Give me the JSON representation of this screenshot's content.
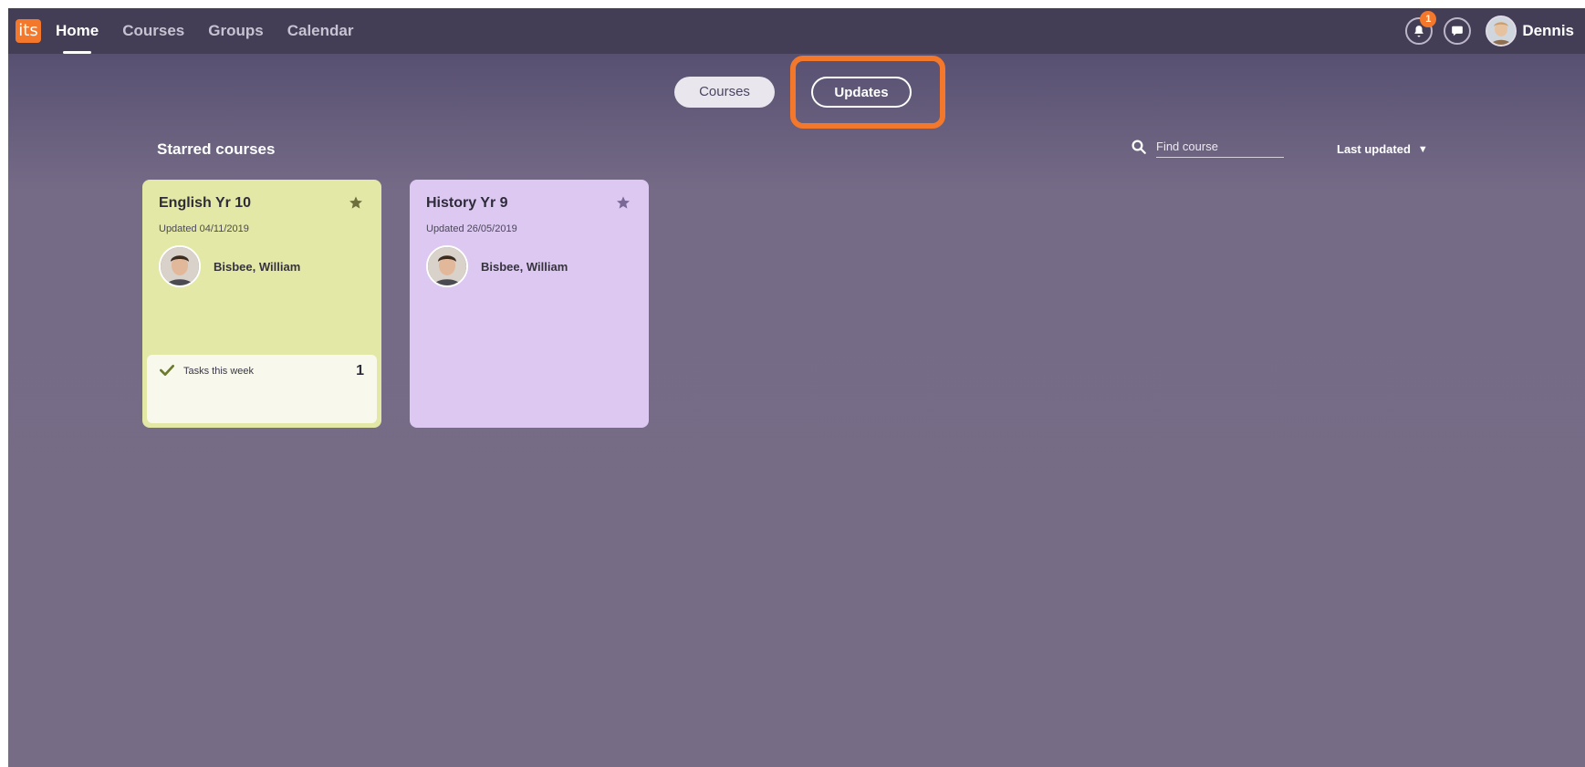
{
  "app": {
    "logo_text": "its"
  },
  "nav": {
    "items": [
      {
        "label": "Home",
        "active": true
      },
      {
        "label": "Courses",
        "active": false
      },
      {
        "label": "Groups",
        "active": false
      },
      {
        "label": "Calendar",
        "active": false
      }
    ]
  },
  "header": {
    "notification_count": "1",
    "user_name": "Dennis"
  },
  "view_toggle": {
    "courses_label": "Courses",
    "updates_label": "Updates"
  },
  "main": {
    "section_title": "Starred courses",
    "search_placeholder": "Find course",
    "sort_label": "Last updated",
    "courses": [
      {
        "title": "English Yr 10",
        "updated": "Updated 04/11/2019",
        "teacher": "Bisbee, William",
        "tasks_label": "Tasks this week",
        "tasks_count": "1"
      },
      {
        "title": "History Yr 9",
        "updated": "Updated 26/05/2019",
        "teacher": "Bisbee, William"
      }
    ]
  },
  "colors": {
    "accent": "#f3782b",
    "topbar": "#433d55",
    "background": "#776c86",
    "english_card": "#e3e8a7",
    "history_card": "#dcc8f1"
  }
}
